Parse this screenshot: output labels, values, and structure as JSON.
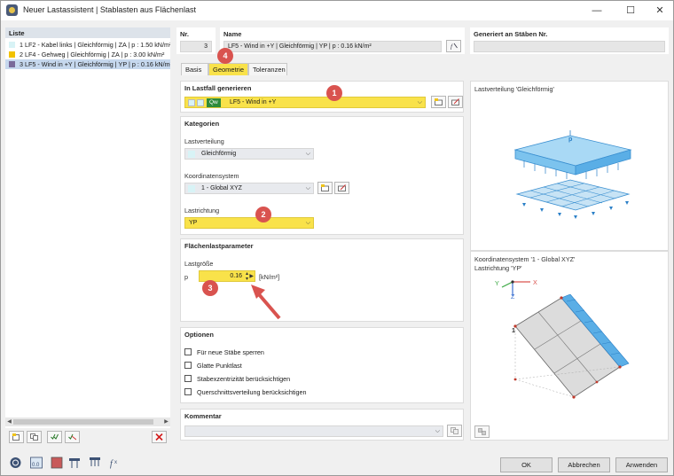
{
  "window": {
    "title": "Neuer Lastassistent | Stablasten aus Flächenlast",
    "minimize_glyph": "—",
    "maximize_glyph": "☐",
    "close_glyph": "✕"
  },
  "list": {
    "header": "Liste",
    "items": [
      {
        "label": "1  LF2 - Kabel links | Gleichförmig | ZA | p : 1.50 kN/m²",
        "color": "#d8f3f6"
      },
      {
        "label": "2  LF4 - Gehweg | Gleichförmig | ZA | p : 3.00 kN/m²",
        "color": "#f2c200"
      },
      {
        "label": "3  LF5 - Wind in +Y | Gleichförmig | YP | p : 0.16 kN/m²",
        "color": "#7a6a9a"
      }
    ],
    "selected_index": 2
  },
  "header": {
    "nr_label": "Nr.",
    "nr_value": "3",
    "name_label": "Name",
    "name_value": "LF5 - Wind in +Y | Gleichförmig | YP | p : 0.16 kN/m²",
    "generated_label": "Generiert an Stäben Nr."
  },
  "tabs": [
    {
      "label": "Basis",
      "active": false
    },
    {
      "label": "Geometrie",
      "active": true
    },
    {
      "label": "Toleranzen",
      "active": false
    }
  ],
  "loadcase": {
    "section_title": "In Lastfall generieren",
    "tag": "Qw",
    "value": "LF5 - Wind in +Y"
  },
  "categories": {
    "section_title": "Kategorien",
    "distribution_label": "Lastverteilung",
    "distribution_value": "Gleichförmig",
    "coord_label": "Koordinatensystem",
    "coord_value": "1 - Global XYZ",
    "direction_label": "Lastrichtung",
    "direction_value": "YP"
  },
  "params": {
    "section_title": "Flächenlastparameter",
    "size_label": "Lastgröße",
    "symbol": "p",
    "value": "0.16",
    "unit": "[kN/m²]"
  },
  "options": {
    "section_title": "Optionen",
    "items": [
      "Für neue Stäbe sperren",
      "Glatte Punktlast",
      "Stabexzentrizität berücksichtigen",
      "Querschnittsverteilung berücksichtigen"
    ]
  },
  "comment": {
    "section_title": "Kommentar"
  },
  "preview": {
    "top_caption": "Lastverteilung 'Gleichförmig'",
    "top_p_label": "p",
    "bottom_caption_1": "Koordinatensystem '1 - Global XYZ'",
    "bottom_caption_2": "Lastrichtung 'YP'",
    "axis_x": "X",
    "axis_y": "Y",
    "axis_z": "Z",
    "node_label": "1"
  },
  "badges": [
    "1",
    "2",
    "3",
    "4"
  ],
  "buttons": {
    "ok": "OK",
    "cancel": "Abbrechen",
    "apply": "Anwenden"
  },
  "colors": {
    "accent_yellow": "#f9e24a",
    "badge_red": "#d9534f",
    "selection_blue": "#c6d8ee",
    "load_blue": "#5aaee6"
  }
}
